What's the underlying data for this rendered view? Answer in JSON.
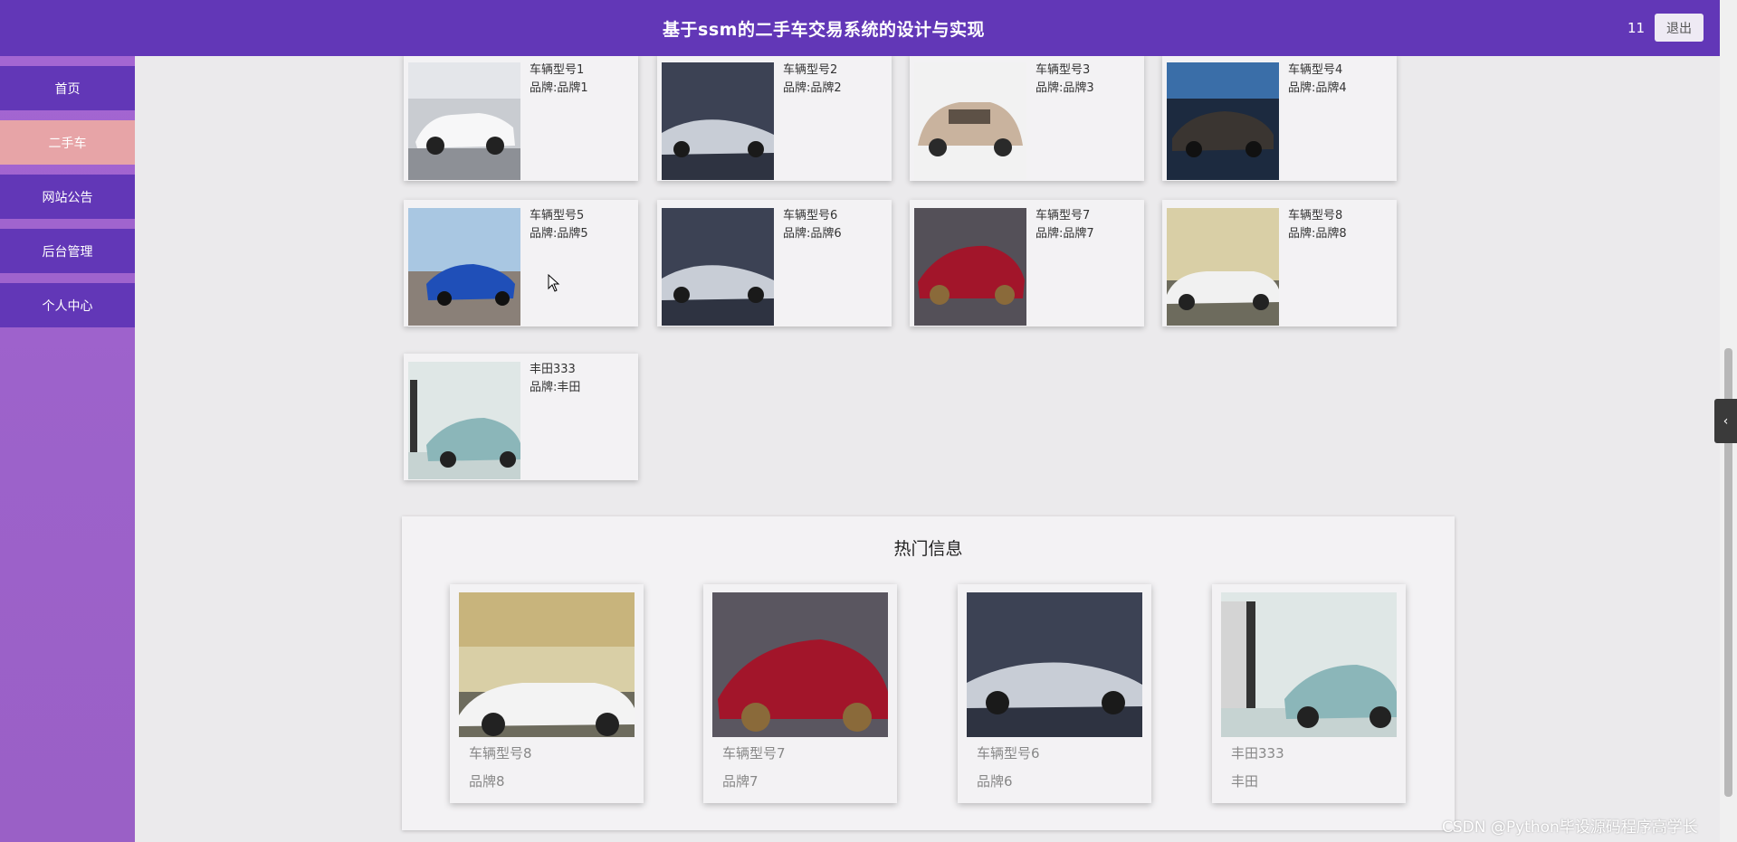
{
  "header": {
    "title": "基于ssm的二手车交易系统的设计与实现",
    "user": "11",
    "logout_label": "退出"
  },
  "sidebar": {
    "items": [
      {
        "label": "首页",
        "active": false
      },
      {
        "label": "二手车",
        "active": true
      },
      {
        "label": "网站公告",
        "active": false
      },
      {
        "label": "后台管理",
        "active": false
      },
      {
        "label": "个人中心",
        "active": false
      }
    ]
  },
  "cars": [
    {
      "name": "车辆型号1",
      "brand": "品牌:品牌1",
      "image": "white-bmw-sedan-showroom"
    },
    {
      "name": "车辆型号2",
      "brand": "品牌:品牌2",
      "image": "silver-sports-car-dark"
    },
    {
      "name": "车辆型号3",
      "brand": "品牌:品牌3",
      "image": "beige-hatchback"
    },
    {
      "name": "车辆型号4",
      "brand": "品牌:品牌4",
      "image": "black-sedan-blue-sky"
    },
    {
      "name": "车辆型号5",
      "brand": "品牌:品牌5",
      "image": "blue-sports-car-pier"
    },
    {
      "name": "车辆型号6",
      "brand": "品牌:品牌6",
      "image": "silver-sports-car-dark"
    },
    {
      "name": "车辆型号7",
      "brand": "品牌:品牌7",
      "image": "red-sports-car"
    },
    {
      "name": "车辆型号8",
      "brand": "品牌:品牌8",
      "image": "white-convertible-sunset"
    },
    {
      "name": "丰田333",
      "brand": "品牌:丰田",
      "image": "teal-sports-car"
    }
  ],
  "hot": {
    "title": "热门信息",
    "items": [
      {
        "name": "车辆型号8",
        "brand": "品牌8",
        "image": "white-convertible-sunset"
      },
      {
        "name": "车辆型号7",
        "brand": "品牌7",
        "image": "red-sports-car"
      },
      {
        "name": "车辆型号6",
        "brand": "品牌6",
        "image": "silver-sports-car-dark"
      },
      {
        "name": "丰田333",
        "brand": "丰田",
        "image": "teal-sports-car"
      }
    ]
  },
  "side_toggle_icon": "chevron-left-icon",
  "watermark": "CSDN @Python毕设源码程序高学长",
  "colors": {
    "header": "#6237b7",
    "sidebar_active": "#e7a4a7",
    "sidebar_bg": "#9d62cb",
    "page_bg": "#ebeaec"
  }
}
